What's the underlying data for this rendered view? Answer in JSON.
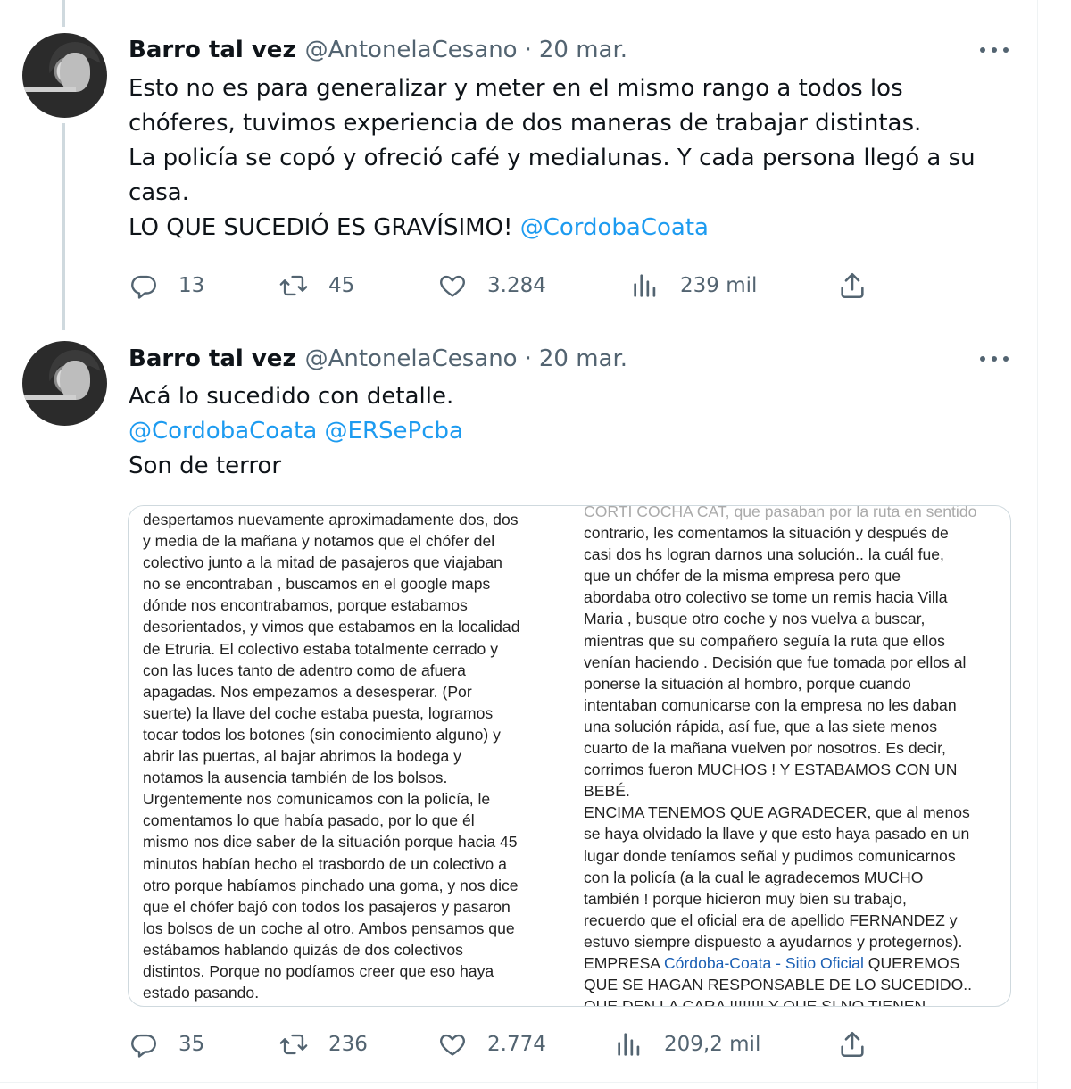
{
  "tweets": [
    {
      "author_name": "Barro tal vez",
      "handle": "@AntonelaCesano",
      "separator": "·",
      "date": "20 mar.",
      "text_lines": [
        "Esto no es para generalizar y meter en el mismo rango a todos los",
        "chóferes, tuvimos experiencia de dos maneras de trabajar distintas.",
        "La policía se copó y ofreció café y medialunas.  Y cada persona llegó a su",
        "casa.",
        "LO QUE SUCEDIÓ ES GRAVÍSIMO! "
      ],
      "mention": "@CordobaCoata",
      "replies": "13",
      "retweets": "45",
      "likes": "3.284",
      "views": "239 mil"
    },
    {
      "author_name": "Barro tal vez",
      "handle": "@AntonelaCesano",
      "separator": "·",
      "date": "20 mar.",
      "text_line1": "Acá lo sucedido con detalle.",
      "mention1": "@CordobaCoata",
      "mention2": "@ERSePcba",
      "text_line3": "Son de terror",
      "replies": "35",
      "retweets": "236",
      "likes": "2.774",
      "views": "209,2 mil"
    }
  ],
  "image_text": {
    "left_column": [
      "despertamos nuevamente aproximadamente dos, dos",
      "y media de la mañana y notamos que el chófer del",
      "colectivo junto a la mitad de pasajeros que viajaban",
      "no se encontraban , buscamos en el google maps",
      "dónde nos encontrabamos, porque estabamos",
      "desorientados, y vimos que estabamos en la localidad",
      "de Etruria. El colectivo estaba totalmente cerrado y",
      "con las luces tanto de adentro como de afuera",
      "apagadas. Nos empezamos a desesperar. (Por",
      "suerte) la llave del coche estaba puesta, logramos",
      "tocar todos los botones (sin conocimiento alguno) y",
      "abrir las puertas, al bajar abrimos la bodega y",
      "notamos la ausencia también de los bolsos.",
      "Urgentemente nos comunicamos con la policía,  le",
      "comentamos lo que había pasado, por lo que él",
      "mismo nos dice saber de la situación  porque hacia 45",
      "minutos habían hecho el trasbordo de un colectivo a",
      "otro porque habíamos pinchado una goma, y nos dice",
      "que el chófer bajó  con todos los pasajeros y pasaron",
      "los bolsos de un coche al otro. Ambos pensamos que",
      "estábamos hablando quizás de dos colectivos",
      "distintos. Porque no podíamos creer que eso haya",
      "estado pasando."
    ],
    "right_column_top": "CORTI COCHA CAT, que pasaban por la ruta en sentido",
    "right_column": [
      "contrario, les  comentamos la situación y después de",
      "casi dos hs logran darnos una solución..  la cuál fue,",
      "que un chófer de la misma empresa pero que",
      "abordaba otro colectivo se  tome un remis hacia Villa",
      "Maria , busque otro coche y nos vuelva a buscar,",
      "mientras que su compañero seguía la ruta que ellos",
      "venían haciendo . Decisión que fue tomada por ellos al",
      "ponerse la situación al hombro, porque cuando",
      "intentaban comunicarse con la empresa no les daban",
      "una solución rápida, así fue, que a las siete menos",
      "cuarto  de la mañana vuelven por nosotros. Es decir,",
      "corrimos fueron MUCHOS !  Y ESTABAMOS CON UN",
      "BEBÉ.",
      " ENCIMA TENEMOS QUE AGRADECER,  que al menos",
      "se haya olvidado la llave y que esto haya pasado en un",
      "lugar donde teníamos señal y pudimos comunicarnos",
      "con la policía (a la cual le agradecemos MUCHO",
      "también  ! porque hicieron muy bien su trabajo,",
      "recuerdo que el oficial era de apellido FERNANDEZ  y",
      "estuvo siempre dispuesto a ayudarnos y protegernos)."
    ],
    "empresa_prefix": "EMPRESA ",
    "empresa_link": "Córdoba-Coata - Sitio Oficial",
    "empresa_suffix": "  QUEREMOS",
    "tail_lines": [
      "QUE SE HAGAN RESPONSABLE DE LO SUCEDIDO..",
      "QUE DEN LA CARA !!!!!!!! Y QUE SI NO TIENEN"
    ]
  },
  "icons": [
    "reply-icon",
    "retweet-icon",
    "like-icon",
    "views-icon",
    "share-icon",
    "more-icon"
  ],
  "colors": {
    "link": "#1d9bf0",
    "muted": "#536471",
    "text": "#0f1419",
    "thread_line": "#cfd9de"
  }
}
